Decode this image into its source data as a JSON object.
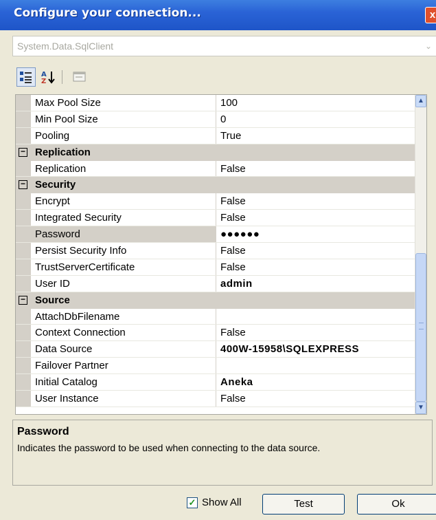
{
  "window": {
    "title": "Configure your connection...",
    "close_glyph": "x"
  },
  "provider": {
    "value": "System.Data.SqlClient"
  },
  "toolbar": {
    "categorized_icon": "categorized-view-icon",
    "alphabetical_icon": "alphabetical-sort-icon",
    "property_pages_icon": "property-pages-icon"
  },
  "grid": {
    "rows": [
      {
        "type": "prop",
        "name": "Max Pool Size",
        "value": "100"
      },
      {
        "type": "prop",
        "name": "Min Pool Size",
        "value": "0"
      },
      {
        "type": "prop",
        "name": "Pooling",
        "value": "True"
      },
      {
        "type": "category",
        "name": "Replication",
        "toggle": "−"
      },
      {
        "type": "prop",
        "name": "Replication",
        "value": "False"
      },
      {
        "type": "category",
        "name": "Security",
        "toggle": "−"
      },
      {
        "type": "prop",
        "name": "Encrypt",
        "value": "False"
      },
      {
        "type": "prop",
        "name": "Integrated Security",
        "value": "False"
      },
      {
        "type": "prop",
        "name": "Password",
        "value": "●●●●●●",
        "selected": true,
        "bold": true
      },
      {
        "type": "prop",
        "name": "Persist Security Info",
        "value": "False"
      },
      {
        "type": "prop",
        "name": "TrustServerCertificate",
        "value": "False"
      },
      {
        "type": "prop",
        "name": "User ID",
        "value": "admin",
        "bold": true
      },
      {
        "type": "category",
        "name": "Source",
        "toggle": "−"
      },
      {
        "type": "prop",
        "name": "AttachDbFilename",
        "value": ""
      },
      {
        "type": "prop",
        "name": "Context Connection",
        "value": "False"
      },
      {
        "type": "prop",
        "name": "Data Source",
        "value": "400W-15958\\SQLEXPRESS",
        "bold": true
      },
      {
        "type": "prop",
        "name": "Failover Partner",
        "value": ""
      },
      {
        "type": "prop",
        "name": "Initial Catalog",
        "value": "Aneka",
        "bold": true
      },
      {
        "type": "prop",
        "name": "User Instance",
        "value": "False"
      }
    ]
  },
  "description": {
    "title": "Password",
    "text": "Indicates the password to be used when connecting to the data source."
  },
  "footer": {
    "show_all_label": "Show All",
    "show_all_checked": true,
    "test_label": "Test",
    "ok_label": "Ok"
  }
}
